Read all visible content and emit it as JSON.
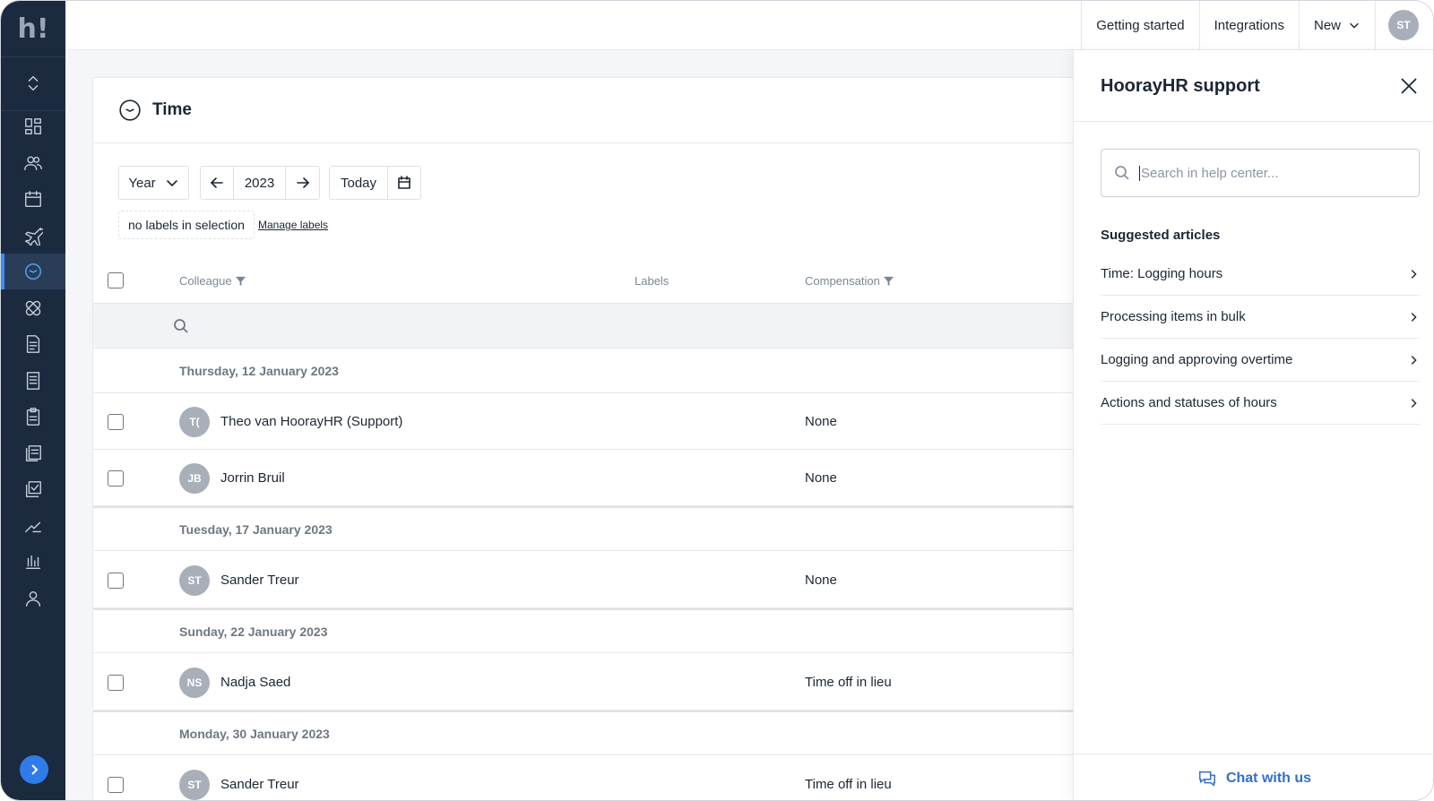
{
  "app": {
    "logo_text": "h!"
  },
  "topnav": {
    "getting_started": "Getting started",
    "integrations": "Integrations",
    "new": "New",
    "user_initials": "ST"
  },
  "sidebar": {
    "items": [
      {
        "icon": "dashboard-icon"
      },
      {
        "icon": "people-icon"
      },
      {
        "icon": "calendar-icon"
      },
      {
        "icon": "plane-icon"
      },
      {
        "icon": "clock-icon",
        "active": true
      },
      {
        "icon": "bandage-icon"
      },
      {
        "icon": "document-icon"
      },
      {
        "icon": "receipt-icon"
      },
      {
        "icon": "clipboard-icon"
      },
      {
        "icon": "documents-icon"
      },
      {
        "icon": "checklist-icon"
      },
      {
        "icon": "trend-icon"
      },
      {
        "icon": "bar-chart-icon"
      },
      {
        "icon": "user-icon"
      }
    ]
  },
  "page": {
    "title": "Time",
    "period": "Year",
    "year": "2023",
    "today": "Today",
    "labels_status": "no labels in selection",
    "manage_labels": "Manage labels"
  },
  "table": {
    "columns": {
      "colleague": "Colleague",
      "labels": "Labels",
      "compensation": "Compensation"
    },
    "groups": [
      {
        "date": "Thursday, 12 January 2023",
        "rows": [
          {
            "initials": "T(",
            "name": "Theo van HoorayHR (Support)",
            "compensation": "None"
          },
          {
            "initials": "JB",
            "name": "Jorrin Bruil",
            "compensation": "None"
          }
        ]
      },
      {
        "date": "Tuesday, 17 January 2023",
        "rows": [
          {
            "initials": "ST",
            "name": "Sander Treur",
            "compensation": "None"
          }
        ]
      },
      {
        "date": "Sunday, 22 January 2023",
        "rows": [
          {
            "initials": "NS",
            "name": "Nadja Saed",
            "compensation": "Time off in lieu"
          }
        ]
      },
      {
        "date": "Monday, 30 January 2023",
        "rows": [
          {
            "initials": "ST",
            "name": "Sander Treur",
            "compensation": "Time off in lieu"
          }
        ]
      }
    ]
  },
  "support": {
    "title": "HoorayHR support",
    "search_placeholder": "Search in help center...",
    "suggested_title": "Suggested articles",
    "articles": [
      "Time: Logging hours",
      "Processing items in bulk",
      "Logging and approving overtime",
      "Actions and statuses of hours"
    ],
    "chat": "Chat with us"
  },
  "colors": {
    "sidebar_bg": "#1b2a3f",
    "accent": "#2f7ce8",
    "link": "#2f6fd0"
  }
}
